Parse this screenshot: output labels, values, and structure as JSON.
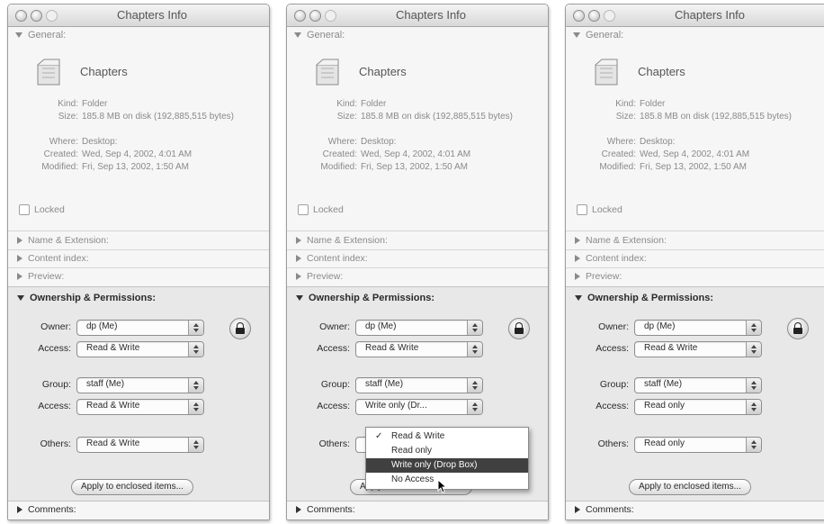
{
  "windows": [
    {
      "title": "Chapters Info",
      "general": {
        "header": "General:",
        "name": "Chapters",
        "kind_label": "Kind:",
        "kind": "Folder",
        "size_label": "Size:",
        "size": "185.8 MB on disk (192,885,515 bytes)",
        "where_label": "Where:",
        "where": "Desktop:",
        "created_label": "Created:",
        "created": "Wed, Sep 4, 2002, 4:01 AM",
        "modified_label": "Modified:",
        "modified": "Fri, Sep 13, 2002, 1:50 AM",
        "locked": "Locked"
      },
      "sections": [
        "Name & Extension:",
        "Content index:",
        "Preview:"
      ],
      "permissions": {
        "header": "Ownership & Permissions:",
        "owner_label": "Owner:",
        "owner": "dp (Me)",
        "owner_access_label": "Access:",
        "owner_access": "Read & Write",
        "group_label": "Group:",
        "group": "staff (Me)",
        "group_access_label": "Access:",
        "group_access": "Read & Write",
        "others_label": "Others:",
        "others": "Read & Write",
        "apply": "Apply to enclosed items..."
      },
      "comments": "Comments:"
    },
    {
      "title": "Chapters Info",
      "general": {
        "header": "General:",
        "name": "Chapters",
        "kind_label": "Kind:",
        "kind": "Folder",
        "size_label": "Size:",
        "size": "185.8 MB on disk (192,885,515 bytes)",
        "where_label": "Where:",
        "where": "Desktop:",
        "created_label": "Created:",
        "created": "Wed, Sep 4, 2002, 4:01 AM",
        "modified_label": "Modified:",
        "modified": "Fri, Sep 13, 2002, 1:50 AM",
        "locked": "Locked"
      },
      "sections": [
        "Name & Extension:",
        "Content index:",
        "Preview:"
      ],
      "permissions": {
        "header": "Ownership & Permissions:",
        "owner_label": "Owner:",
        "owner": "dp (Me)",
        "owner_access_label": "Access:",
        "owner_access": "Read & Write",
        "group_label": "Group:",
        "group": "staff (Me)",
        "group_access_label": "Access:",
        "group_access": "Write only (Dr...",
        "others_label": "Others:",
        "others": "Read & Write",
        "apply": "Apply to enclosed items..."
      },
      "comments": "Comments:",
      "others_menu": {
        "items": [
          "Read & Write",
          "Read only",
          "Write only (Drop Box)",
          "No Access"
        ],
        "checked": "Read & Write",
        "highlighted": "Write only (Drop Box)"
      }
    },
    {
      "title": "Chapters Info",
      "general": {
        "header": "General:",
        "name": "Chapters",
        "kind_label": "Kind:",
        "kind": "Folder",
        "size_label": "Size:",
        "size": "185.8 MB on disk (192,885,515 bytes)",
        "where_label": "Where:",
        "where": "Desktop:",
        "created_label": "Created:",
        "created": "Wed, Sep 4, 2002, 4:01 AM",
        "modified_label": "Modified:",
        "modified": "Fri, Sep 13, 2002, 1:50 AM",
        "locked": "Locked"
      },
      "sections": [
        "Name & Extension:",
        "Content index:",
        "Preview:"
      ],
      "permissions": {
        "header": "Ownership & Permissions:",
        "owner_label": "Owner:",
        "owner": "dp (Me)",
        "owner_access_label": "Access:",
        "owner_access": "Read & Write",
        "group_label": "Group:",
        "group": "staff (Me)",
        "group_access_label": "Access:",
        "group_access": "Read only",
        "others_label": "Others:",
        "others": "Read only",
        "apply": "Apply to enclosed items..."
      },
      "comments": "Comments:"
    }
  ]
}
